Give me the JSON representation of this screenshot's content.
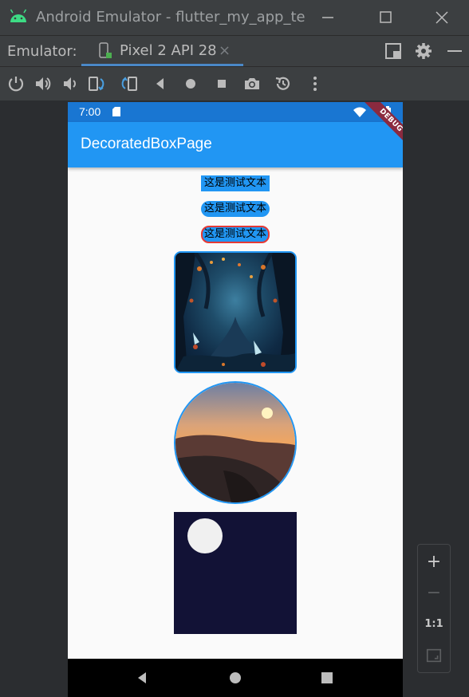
{
  "window": {
    "title": "Android Emulator - flutter_my_app_te",
    "icons": [
      "android-logo-icon",
      "minimize-icon",
      "maximize-icon",
      "close-icon"
    ]
  },
  "tabbar": {
    "label": "Emulator:",
    "tab_name": "Pixel 2 API 28",
    "tab_close": "×"
  },
  "toolbar": {
    "items": [
      "power-icon",
      "volume-up-icon",
      "volume-down-icon",
      "rotate-left-icon",
      "rotate-right-icon",
      "back-icon",
      "home-icon",
      "overview-icon",
      "screenshot-icon",
      "snapshot-icon",
      "more-icon"
    ]
  },
  "phone": {
    "status": {
      "time": "7:00"
    },
    "appbar": {
      "title": "DecoratedBoxPage"
    },
    "debug_label": "DEBUG",
    "texts": [
      "这是测试文本",
      "这是测试文本",
      "这是测试文本"
    ]
  },
  "zoom": {
    "plus": "+",
    "minus": "−",
    "ratio": "1:1"
  },
  "colors": {
    "status_bar": "#1976d2",
    "app_bar": "#2196f3",
    "accent_red": "#e53935",
    "navy": "#121236"
  }
}
